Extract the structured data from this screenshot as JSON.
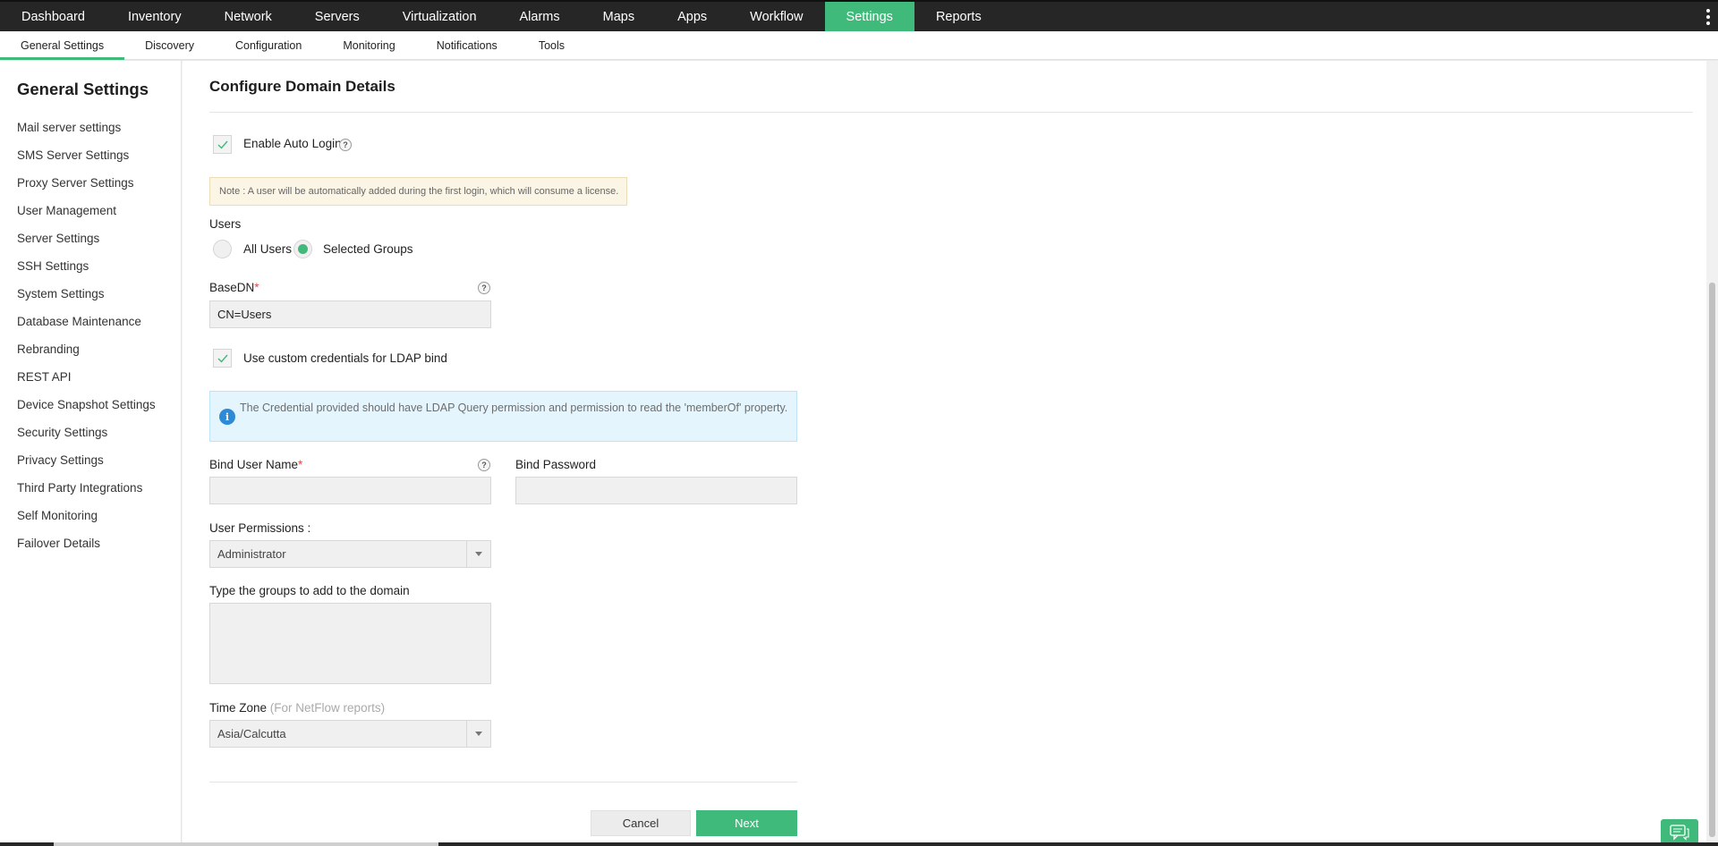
{
  "topnav": {
    "items": [
      "Dashboard",
      "Inventory",
      "Network",
      "Servers",
      "Virtualization",
      "Alarms",
      "Maps",
      "Apps",
      "Workflow",
      "Settings",
      "Reports"
    ],
    "active": "Settings",
    "accent": "#3fba7a"
  },
  "subnav": {
    "items": [
      "General Settings",
      "Discovery",
      "Configuration",
      "Monitoring",
      "Notifications",
      "Tools"
    ],
    "active": "General Settings"
  },
  "sidebar": {
    "title": "General Settings",
    "items": [
      "Mail server settings",
      "SMS Server Settings",
      "Proxy Server Settings",
      "User Management",
      "Server Settings",
      "SSH Settings",
      "System Settings",
      "Database Maintenance",
      "Rebranding",
      "REST API",
      "Device Snapshot Settings",
      "Security Settings",
      "Privacy Settings",
      "Third Party Integrations",
      "Self Monitoring",
      "Failover Details"
    ]
  },
  "form": {
    "title": "Configure Domain Details",
    "auto_login_label": "Enable Auto Login",
    "auto_login_checked": true,
    "note": "Note : A user will be automatically added during the first login, which will consume a license.",
    "users_label": "Users",
    "users_options": [
      "All Users",
      "Selected Groups"
    ],
    "users_selected": "Selected Groups",
    "basedn_label": "BaseDN",
    "basedn_value": "CN=Users",
    "custom_cred_label": "Use custom credentials for LDAP bind",
    "custom_cred_checked": true,
    "info_text": "The Credential provided should have LDAP Query permission and permission to read the 'memberOf' property.",
    "bind_user_label": "Bind User Name",
    "bind_user_value": "",
    "bind_password_label": "Bind Password",
    "bind_password_value": "",
    "permissions_label": "User Permissions :",
    "permissions_value": "Administrator",
    "groups_label": "Type the groups to add to the domain",
    "groups_value": "",
    "timezone_label": "Time Zone",
    "timezone_hint": "(For NetFlow reports)",
    "timezone_value": "Asia/Calcutta",
    "required_mark": "*",
    "help_mark": "?",
    "info_mark": "i",
    "cancel_label": "Cancel",
    "next_label": "Next"
  },
  "icons": {
    "help": "question-icon",
    "info": "info-icon",
    "chat": "chat-icon",
    "menu": "kebab-menu-icon"
  }
}
